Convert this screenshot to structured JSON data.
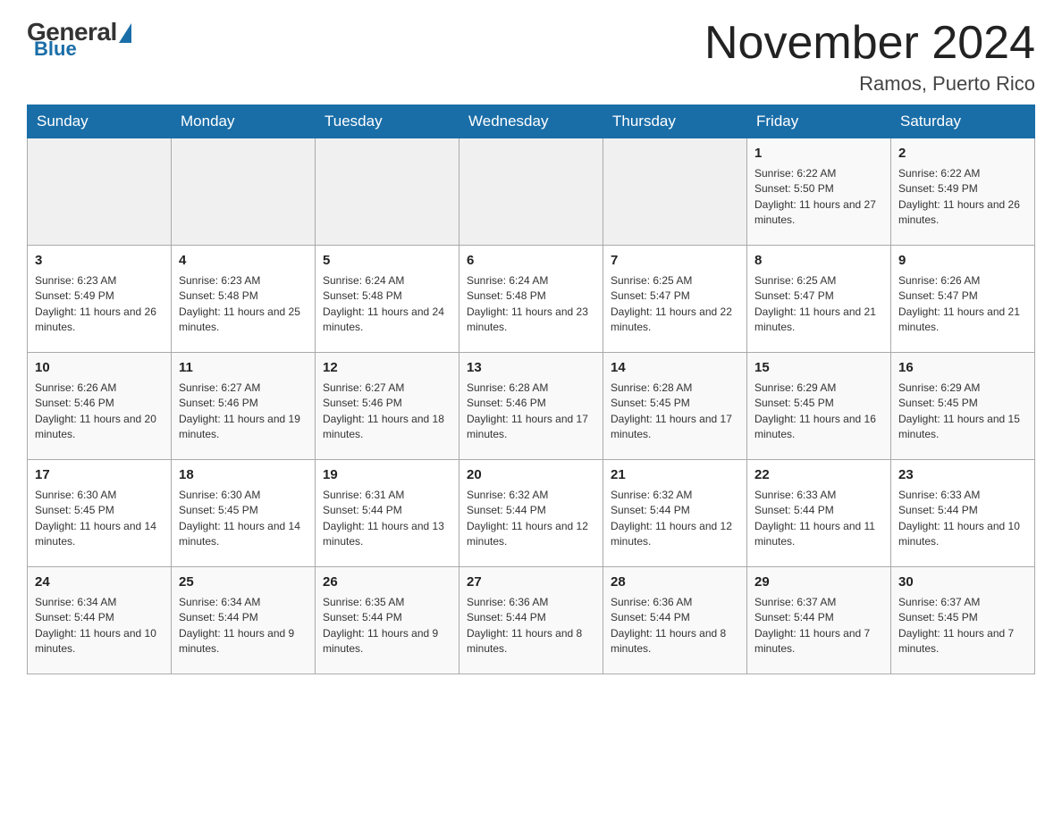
{
  "header": {
    "logo": {
      "general": "General",
      "blue": "Blue"
    },
    "title": "November 2024",
    "location": "Ramos, Puerto Rico"
  },
  "weekdays": [
    "Sunday",
    "Monday",
    "Tuesday",
    "Wednesday",
    "Thursday",
    "Friday",
    "Saturday"
  ],
  "weeks": [
    [
      {
        "day": "",
        "sunrise": "",
        "sunset": "",
        "daylight": ""
      },
      {
        "day": "",
        "sunrise": "",
        "sunset": "",
        "daylight": ""
      },
      {
        "day": "",
        "sunrise": "",
        "sunset": "",
        "daylight": ""
      },
      {
        "day": "",
        "sunrise": "",
        "sunset": "",
        "daylight": ""
      },
      {
        "day": "",
        "sunrise": "",
        "sunset": "",
        "daylight": ""
      },
      {
        "day": "1",
        "sunrise": "Sunrise: 6:22 AM",
        "sunset": "Sunset: 5:50 PM",
        "daylight": "Daylight: 11 hours and 27 minutes."
      },
      {
        "day": "2",
        "sunrise": "Sunrise: 6:22 AM",
        "sunset": "Sunset: 5:49 PM",
        "daylight": "Daylight: 11 hours and 26 minutes."
      }
    ],
    [
      {
        "day": "3",
        "sunrise": "Sunrise: 6:23 AM",
        "sunset": "Sunset: 5:49 PM",
        "daylight": "Daylight: 11 hours and 26 minutes."
      },
      {
        "day": "4",
        "sunrise": "Sunrise: 6:23 AM",
        "sunset": "Sunset: 5:48 PM",
        "daylight": "Daylight: 11 hours and 25 minutes."
      },
      {
        "day": "5",
        "sunrise": "Sunrise: 6:24 AM",
        "sunset": "Sunset: 5:48 PM",
        "daylight": "Daylight: 11 hours and 24 minutes."
      },
      {
        "day": "6",
        "sunrise": "Sunrise: 6:24 AM",
        "sunset": "Sunset: 5:48 PM",
        "daylight": "Daylight: 11 hours and 23 minutes."
      },
      {
        "day": "7",
        "sunrise": "Sunrise: 6:25 AM",
        "sunset": "Sunset: 5:47 PM",
        "daylight": "Daylight: 11 hours and 22 minutes."
      },
      {
        "day": "8",
        "sunrise": "Sunrise: 6:25 AM",
        "sunset": "Sunset: 5:47 PM",
        "daylight": "Daylight: 11 hours and 21 minutes."
      },
      {
        "day": "9",
        "sunrise": "Sunrise: 6:26 AM",
        "sunset": "Sunset: 5:47 PM",
        "daylight": "Daylight: 11 hours and 21 minutes."
      }
    ],
    [
      {
        "day": "10",
        "sunrise": "Sunrise: 6:26 AM",
        "sunset": "Sunset: 5:46 PM",
        "daylight": "Daylight: 11 hours and 20 minutes."
      },
      {
        "day": "11",
        "sunrise": "Sunrise: 6:27 AM",
        "sunset": "Sunset: 5:46 PM",
        "daylight": "Daylight: 11 hours and 19 minutes."
      },
      {
        "day": "12",
        "sunrise": "Sunrise: 6:27 AM",
        "sunset": "Sunset: 5:46 PM",
        "daylight": "Daylight: 11 hours and 18 minutes."
      },
      {
        "day": "13",
        "sunrise": "Sunrise: 6:28 AM",
        "sunset": "Sunset: 5:46 PM",
        "daylight": "Daylight: 11 hours and 17 minutes."
      },
      {
        "day": "14",
        "sunrise": "Sunrise: 6:28 AM",
        "sunset": "Sunset: 5:45 PM",
        "daylight": "Daylight: 11 hours and 17 minutes."
      },
      {
        "day": "15",
        "sunrise": "Sunrise: 6:29 AM",
        "sunset": "Sunset: 5:45 PM",
        "daylight": "Daylight: 11 hours and 16 minutes."
      },
      {
        "day": "16",
        "sunrise": "Sunrise: 6:29 AM",
        "sunset": "Sunset: 5:45 PM",
        "daylight": "Daylight: 11 hours and 15 minutes."
      }
    ],
    [
      {
        "day": "17",
        "sunrise": "Sunrise: 6:30 AM",
        "sunset": "Sunset: 5:45 PM",
        "daylight": "Daylight: 11 hours and 14 minutes."
      },
      {
        "day": "18",
        "sunrise": "Sunrise: 6:30 AM",
        "sunset": "Sunset: 5:45 PM",
        "daylight": "Daylight: 11 hours and 14 minutes."
      },
      {
        "day": "19",
        "sunrise": "Sunrise: 6:31 AM",
        "sunset": "Sunset: 5:44 PM",
        "daylight": "Daylight: 11 hours and 13 minutes."
      },
      {
        "day": "20",
        "sunrise": "Sunrise: 6:32 AM",
        "sunset": "Sunset: 5:44 PM",
        "daylight": "Daylight: 11 hours and 12 minutes."
      },
      {
        "day": "21",
        "sunrise": "Sunrise: 6:32 AM",
        "sunset": "Sunset: 5:44 PM",
        "daylight": "Daylight: 11 hours and 12 minutes."
      },
      {
        "day": "22",
        "sunrise": "Sunrise: 6:33 AM",
        "sunset": "Sunset: 5:44 PM",
        "daylight": "Daylight: 11 hours and 11 minutes."
      },
      {
        "day": "23",
        "sunrise": "Sunrise: 6:33 AM",
        "sunset": "Sunset: 5:44 PM",
        "daylight": "Daylight: 11 hours and 10 minutes."
      }
    ],
    [
      {
        "day": "24",
        "sunrise": "Sunrise: 6:34 AM",
        "sunset": "Sunset: 5:44 PM",
        "daylight": "Daylight: 11 hours and 10 minutes."
      },
      {
        "day": "25",
        "sunrise": "Sunrise: 6:34 AM",
        "sunset": "Sunset: 5:44 PM",
        "daylight": "Daylight: 11 hours and 9 minutes."
      },
      {
        "day": "26",
        "sunrise": "Sunrise: 6:35 AM",
        "sunset": "Sunset: 5:44 PM",
        "daylight": "Daylight: 11 hours and 9 minutes."
      },
      {
        "day": "27",
        "sunrise": "Sunrise: 6:36 AM",
        "sunset": "Sunset: 5:44 PM",
        "daylight": "Daylight: 11 hours and 8 minutes."
      },
      {
        "day": "28",
        "sunrise": "Sunrise: 6:36 AM",
        "sunset": "Sunset: 5:44 PM",
        "daylight": "Daylight: 11 hours and 8 minutes."
      },
      {
        "day": "29",
        "sunrise": "Sunrise: 6:37 AM",
        "sunset": "Sunset: 5:44 PM",
        "daylight": "Daylight: 11 hours and 7 minutes."
      },
      {
        "day": "30",
        "sunrise": "Sunrise: 6:37 AM",
        "sunset": "Sunset: 5:45 PM",
        "daylight": "Daylight: 11 hours and 7 minutes."
      }
    ]
  ]
}
